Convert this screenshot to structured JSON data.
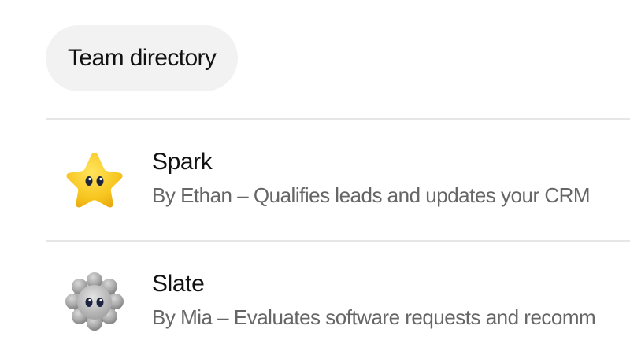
{
  "filter_chip": {
    "label": "Team directory"
  },
  "items": [
    {
      "icon": "star-bot-icon",
      "title": "Spark",
      "subtitle": "By Ethan – Qualifies leads and updates your CRM",
      "icon_color": "#F7C51E"
    },
    {
      "icon": "gear-bot-icon",
      "title": "Slate",
      "subtitle": "By Mia – Evaluates software requests and recomm",
      "icon_color": "#9A9A9A"
    }
  ]
}
